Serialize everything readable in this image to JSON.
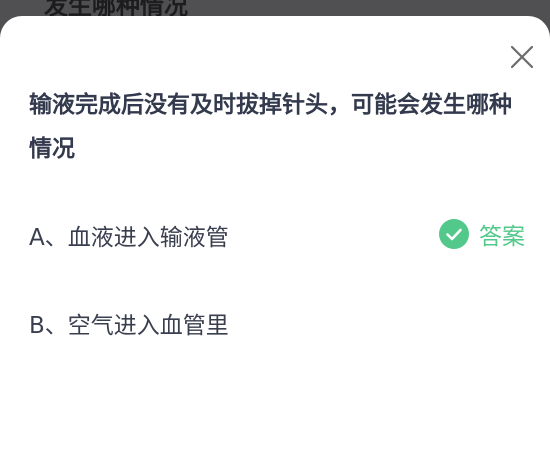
{
  "backdrop": {
    "partial_text": "发生哪种情况"
  },
  "dialog": {
    "question": "输液完成后没有及时拔掉针头，可能会发生哪种情况",
    "close_icon": "close-icon",
    "options": [
      {
        "label": "A、血液进入输液管",
        "is_answer": true,
        "answer_label": "答案",
        "answer_icon": "check-circle-icon"
      },
      {
        "label": "B、空气进入血管里",
        "is_answer": false
      }
    ]
  },
  "colors": {
    "question_text": "#333a4d",
    "option_text": "#3a3f4f",
    "answer_green": "#52c88a",
    "close_icon": "#6b6b6b",
    "backdrop": "#505052",
    "sheet": "#ffffff"
  }
}
